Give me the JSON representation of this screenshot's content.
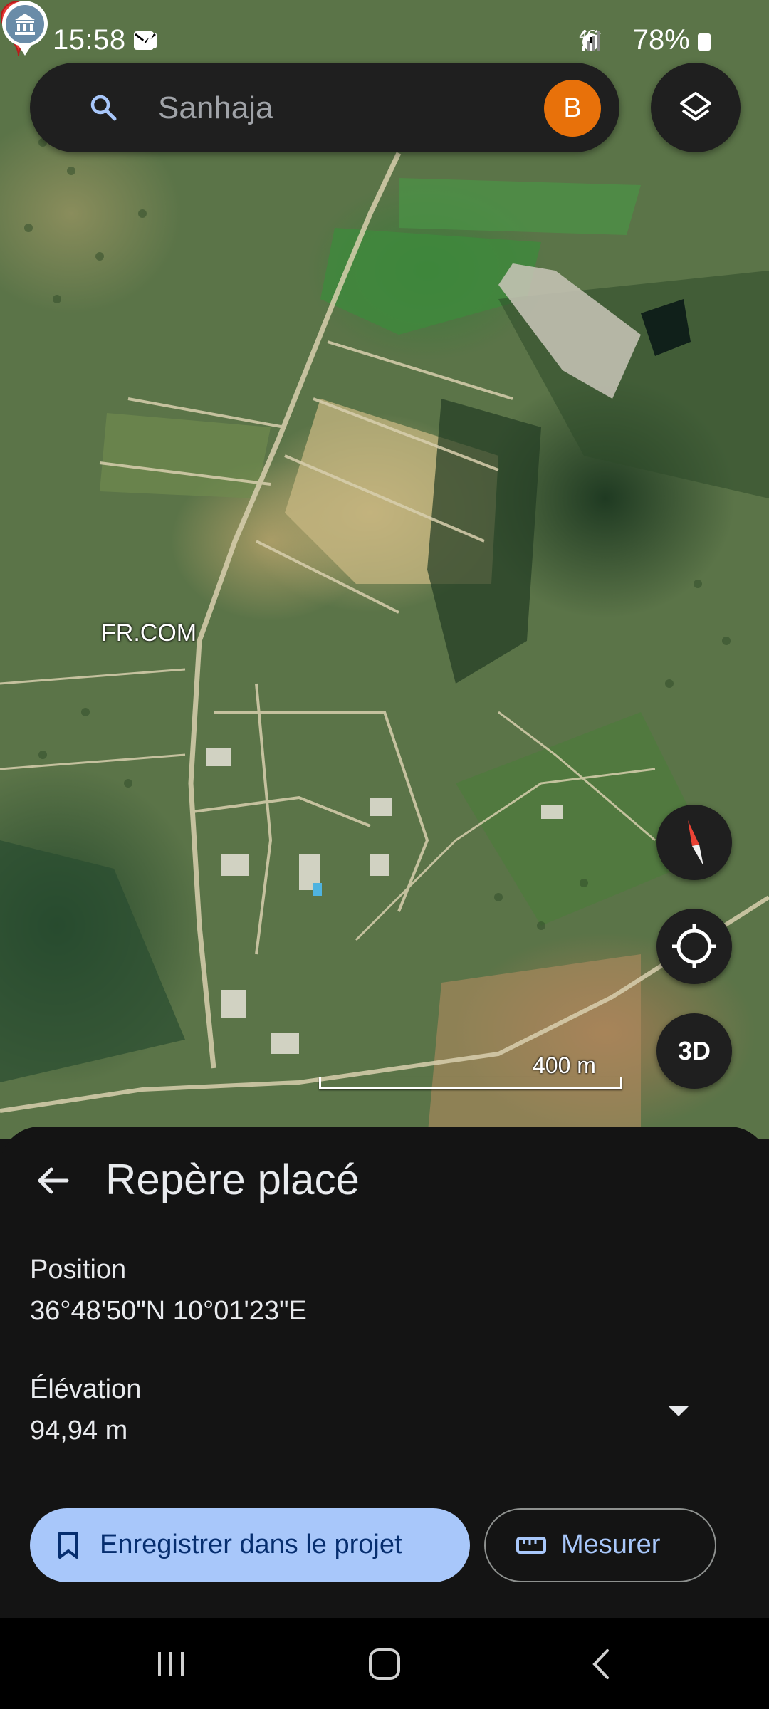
{
  "status_bar": {
    "time": "15:58",
    "battery": "78%",
    "network": "4G",
    "left_icons": [
      "image-icon",
      "message-icon",
      "signal-feed-icon",
      "dot-icon"
    ],
    "right_icons": [
      "alarm-icon",
      "signal-bars-icon",
      "signal-bars-icon"
    ]
  },
  "search": {
    "placeholder": "Sanhaja",
    "avatar_initial": "B",
    "avatar_color": "#e8710a"
  },
  "map": {
    "place_label": "FR.COM",
    "scale_label": "400 m",
    "three_d_label": "3D",
    "pin_color": "#e53935"
  },
  "sheet": {
    "title": "Repère placé",
    "position_label": "Position",
    "position_value": "36°48'50\"N 10°01'23\"E",
    "elevation_label": "Élévation",
    "elevation_value": "94,94 m",
    "save_button_label": "Enregistrer dans le projet",
    "measure_button_label": "Mesurer",
    "accent_color": "#a8c7fa"
  }
}
